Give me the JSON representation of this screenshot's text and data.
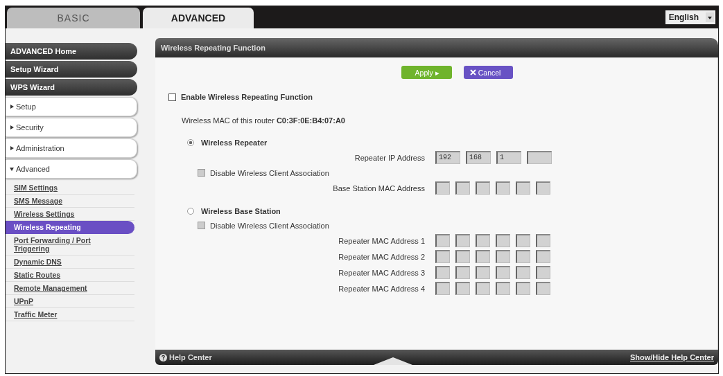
{
  "tabs": [
    {
      "label": "BASIC",
      "selected": false
    },
    {
      "label": "ADVANCED",
      "selected": true
    }
  ],
  "language": {
    "value": "English"
  },
  "sidebar": {
    "items": [
      {
        "kind": "wizard",
        "label": "ADVANCED Home"
      },
      {
        "kind": "wizard",
        "label": "Setup Wizard"
      },
      {
        "kind": "wizard",
        "label": "WPS Wizard"
      },
      {
        "kind": "section",
        "label": "Setup",
        "expanded": false
      },
      {
        "kind": "section",
        "label": "Security",
        "expanded": false
      },
      {
        "kind": "section",
        "label": "Administration",
        "expanded": false
      },
      {
        "kind": "section",
        "label": "Advanced",
        "expanded": true,
        "children": [
          {
            "label": "SIM Settings",
            "selected": false
          },
          {
            "label": "SMS Message",
            "selected": false
          },
          {
            "label": "Wireless Settings",
            "selected": false
          },
          {
            "label": "Wireless Repeating",
            "selected": true
          },
          {
            "label": "Port Forwarding / Port Triggering",
            "selected": false
          },
          {
            "label": "Dynamic DNS",
            "selected": false
          },
          {
            "label": "Static Routes",
            "selected": false
          },
          {
            "label": "Remote Management",
            "selected": false
          },
          {
            "label": "UPnP",
            "selected": false
          },
          {
            "label": "Traffic Meter",
            "selected": false
          }
        ]
      }
    ]
  },
  "panel": {
    "title": "Wireless Repeating Function",
    "buttons": [
      {
        "kind": "apply",
        "label": "Apply ▸"
      },
      {
        "kind": "cancel",
        "label": "Cancel"
      }
    ],
    "rows": [
      {
        "kind": "checkbox",
        "label": "Enable Wireless Repeating Function",
        "checked": false,
        "disabled": false
      },
      {
        "kind": "text",
        "label": "Wireless MAC of this router",
        "value": "C0:3F:0E:B4:07:A0"
      },
      {
        "kind": "radio",
        "label": "Wireless Repeater",
        "selected": true
      },
      {
        "kind": "ip",
        "label": "Repeater IP Address",
        "values": [
          "192",
          "168",
          "1"
        ]
      },
      {
        "kind": "subcheckbox",
        "label": "Disable Wireless Client Association",
        "checked": false,
        "disabled": true
      },
      {
        "kind": "mac",
        "label": "Base Station MAC Address"
      },
      {
        "kind": "radio",
        "label": "Wireless Base Station",
        "selected": false
      },
      {
        "kind": "subcheckbox",
        "label": "Disable Wireless Client Association",
        "checked": false,
        "disabled": true
      },
      {
        "kind": "mac",
        "label": "Repeater MAC Address 1"
      },
      {
        "kind": "mac",
        "label": "Repeater MAC Address 2"
      },
      {
        "kind": "mac",
        "label": "Repeater MAC Address 3"
      },
      {
        "kind": "mac",
        "label": "Repeater MAC Address 4"
      }
    ]
  },
  "footer": {
    "help": "Help Center",
    "toggle": "Show/Hide Help Center"
  }
}
